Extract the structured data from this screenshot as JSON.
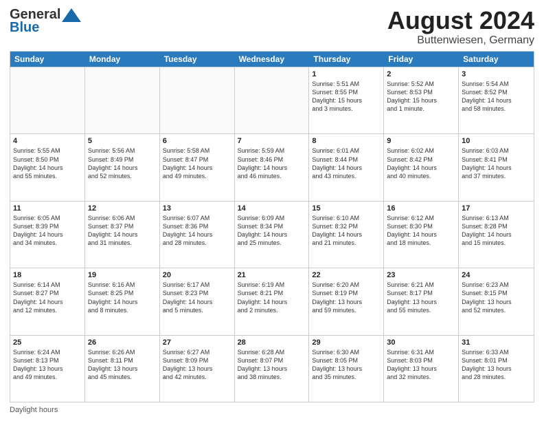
{
  "logo": {
    "line1": "General",
    "line2": "Blue"
  },
  "title": "August 2024",
  "subtitle": "Buttenwiesen, Germany",
  "days": [
    "Sunday",
    "Monday",
    "Tuesday",
    "Wednesday",
    "Thursday",
    "Friday",
    "Saturday"
  ],
  "footer": "Daylight hours",
  "rows": [
    [
      {
        "num": "",
        "info": ""
      },
      {
        "num": "",
        "info": ""
      },
      {
        "num": "",
        "info": ""
      },
      {
        "num": "",
        "info": ""
      },
      {
        "num": "1",
        "info": "Sunrise: 5:51 AM\nSunset: 8:55 PM\nDaylight: 15 hours\nand 3 minutes."
      },
      {
        "num": "2",
        "info": "Sunrise: 5:52 AM\nSunset: 8:53 PM\nDaylight: 15 hours\nand 1 minute."
      },
      {
        "num": "3",
        "info": "Sunrise: 5:54 AM\nSunset: 8:52 PM\nDaylight: 14 hours\nand 58 minutes."
      }
    ],
    [
      {
        "num": "4",
        "info": "Sunrise: 5:55 AM\nSunset: 8:50 PM\nDaylight: 14 hours\nand 55 minutes."
      },
      {
        "num": "5",
        "info": "Sunrise: 5:56 AM\nSunset: 8:49 PM\nDaylight: 14 hours\nand 52 minutes."
      },
      {
        "num": "6",
        "info": "Sunrise: 5:58 AM\nSunset: 8:47 PM\nDaylight: 14 hours\nand 49 minutes."
      },
      {
        "num": "7",
        "info": "Sunrise: 5:59 AM\nSunset: 8:46 PM\nDaylight: 14 hours\nand 46 minutes."
      },
      {
        "num": "8",
        "info": "Sunrise: 6:01 AM\nSunset: 8:44 PM\nDaylight: 14 hours\nand 43 minutes."
      },
      {
        "num": "9",
        "info": "Sunrise: 6:02 AM\nSunset: 8:42 PM\nDaylight: 14 hours\nand 40 minutes."
      },
      {
        "num": "10",
        "info": "Sunrise: 6:03 AM\nSunset: 8:41 PM\nDaylight: 14 hours\nand 37 minutes."
      }
    ],
    [
      {
        "num": "11",
        "info": "Sunrise: 6:05 AM\nSunset: 8:39 PM\nDaylight: 14 hours\nand 34 minutes."
      },
      {
        "num": "12",
        "info": "Sunrise: 6:06 AM\nSunset: 8:37 PM\nDaylight: 14 hours\nand 31 minutes."
      },
      {
        "num": "13",
        "info": "Sunrise: 6:07 AM\nSunset: 8:36 PM\nDaylight: 14 hours\nand 28 minutes."
      },
      {
        "num": "14",
        "info": "Sunrise: 6:09 AM\nSunset: 8:34 PM\nDaylight: 14 hours\nand 25 minutes."
      },
      {
        "num": "15",
        "info": "Sunrise: 6:10 AM\nSunset: 8:32 PM\nDaylight: 14 hours\nand 21 minutes."
      },
      {
        "num": "16",
        "info": "Sunrise: 6:12 AM\nSunset: 8:30 PM\nDaylight: 14 hours\nand 18 minutes."
      },
      {
        "num": "17",
        "info": "Sunrise: 6:13 AM\nSunset: 8:28 PM\nDaylight: 14 hours\nand 15 minutes."
      }
    ],
    [
      {
        "num": "18",
        "info": "Sunrise: 6:14 AM\nSunset: 8:27 PM\nDaylight: 14 hours\nand 12 minutes."
      },
      {
        "num": "19",
        "info": "Sunrise: 6:16 AM\nSunset: 8:25 PM\nDaylight: 14 hours\nand 8 minutes."
      },
      {
        "num": "20",
        "info": "Sunrise: 6:17 AM\nSunset: 8:23 PM\nDaylight: 14 hours\nand 5 minutes."
      },
      {
        "num": "21",
        "info": "Sunrise: 6:19 AM\nSunset: 8:21 PM\nDaylight: 14 hours\nand 2 minutes."
      },
      {
        "num": "22",
        "info": "Sunrise: 6:20 AM\nSunset: 8:19 PM\nDaylight: 13 hours\nand 59 minutes."
      },
      {
        "num": "23",
        "info": "Sunrise: 6:21 AM\nSunset: 8:17 PM\nDaylight: 13 hours\nand 55 minutes."
      },
      {
        "num": "24",
        "info": "Sunrise: 6:23 AM\nSunset: 8:15 PM\nDaylight: 13 hours\nand 52 minutes."
      }
    ],
    [
      {
        "num": "25",
        "info": "Sunrise: 6:24 AM\nSunset: 8:13 PM\nDaylight: 13 hours\nand 49 minutes."
      },
      {
        "num": "26",
        "info": "Sunrise: 6:26 AM\nSunset: 8:11 PM\nDaylight: 13 hours\nand 45 minutes."
      },
      {
        "num": "27",
        "info": "Sunrise: 6:27 AM\nSunset: 8:09 PM\nDaylight: 13 hours\nand 42 minutes."
      },
      {
        "num": "28",
        "info": "Sunrise: 6:28 AM\nSunset: 8:07 PM\nDaylight: 13 hours\nand 38 minutes."
      },
      {
        "num": "29",
        "info": "Sunrise: 6:30 AM\nSunset: 8:05 PM\nDaylight: 13 hours\nand 35 minutes."
      },
      {
        "num": "30",
        "info": "Sunrise: 6:31 AM\nSunset: 8:03 PM\nDaylight: 13 hours\nand 32 minutes."
      },
      {
        "num": "31",
        "info": "Sunrise: 6:33 AM\nSunset: 8:01 PM\nDaylight: 13 hours\nand 28 minutes."
      }
    ]
  ]
}
